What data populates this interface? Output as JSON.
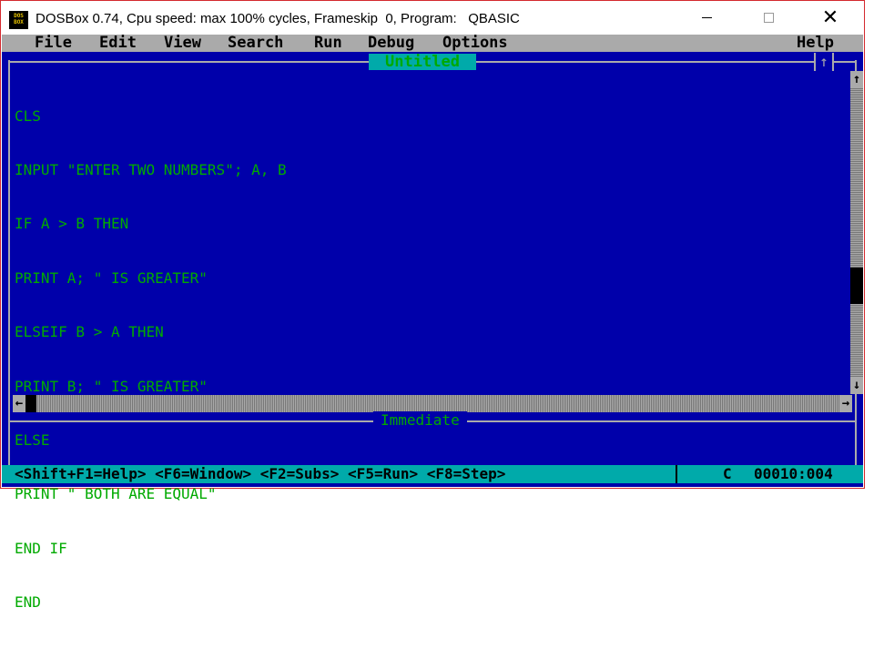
{
  "window": {
    "icon_text": "DOS\nBOX",
    "title": "DOSBox 0.74, Cpu speed: max 100% cycles, Frameskip  0, Program:   QBASIC",
    "min_label": "",
    "max_label": "",
    "close_label": "✕"
  },
  "menu": {
    "items": [
      "File",
      "Edit",
      "View",
      "Search",
      "Run",
      "Debug",
      "Options"
    ],
    "help": "Help"
  },
  "editor": {
    "title": "Untitled",
    "maximize_glyph": "↑",
    "code_lines": [
      "CLS",
      "INPUT \"ENTER TWO NUMBERS\"; A, B",
      "IF A > B THEN",
      "PRINT A; \" IS GREATER\"",
      "ELSEIF B > A THEN",
      "PRINT B; \" IS GREATER\"",
      "ELSE",
      "PRINT \" BOTH ARE EQUAL\"",
      "END IF",
      "END"
    ],
    "scroll_up_glyph": "↑",
    "scroll_down_glyph": "↓",
    "scroll_left_glyph": "←",
    "scroll_right_glyph": "→"
  },
  "immediate": {
    "label": "Immediate"
  },
  "status": {
    "hints": "<Shift+F1=Help> <F6=Window> <F2=Subs> <F5=Run> <F8=Step>",
    "mode": "C",
    "position": "00010:004"
  },
  "colors": {
    "dos_blue": "#0000aa",
    "dos_gray": "#aaaaaa",
    "dos_green": "#00aa00",
    "dos_cyan": "#00aaaa"
  }
}
